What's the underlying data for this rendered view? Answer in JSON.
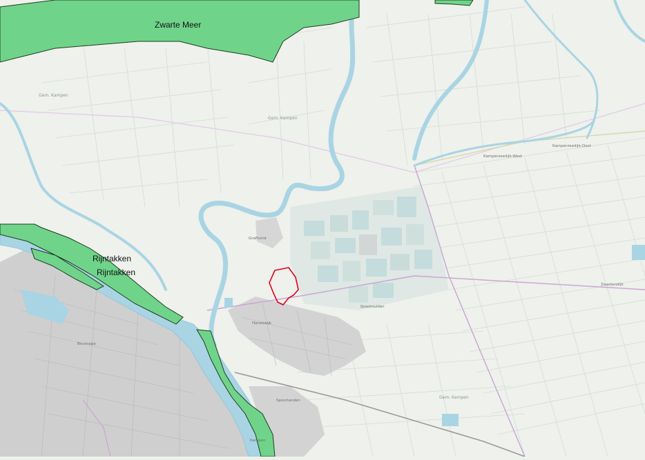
{
  "map": {
    "colors": {
      "background": "#eef1ec",
      "water": "#a9d4e3",
      "water_stroke": "#8fc3d6",
      "natura": "#6fd48a",
      "natura_stroke": "#1f3a1f",
      "urban": "#c9c9c9",
      "greenhouse": "#c4dcdc",
      "parcel": "#dfe4df",
      "road_main": "#c9a4d2",
      "railway": "#9a9a9a",
      "highlight": "#e0001a"
    },
    "natura_labels": {
      "zwarte_meer": "Zwarte Meer",
      "rijntakken_1": "Rijntakken",
      "rijntakken_2": "Rijntakken"
    },
    "place_labels": {
      "kampen": "Kampen",
      "ijsselmuiden": "IJsselmuiden",
      "grafhorst": "Grafhorst",
      "gem_kampen_nw": "Gem. Kampen",
      "gem_kampen_c": "Gem. Kampen",
      "gem_kampen_se": "Gem. Kampen",
      "kamperzeedijk": "Kamperzeedijk-West",
      "zuidelijk": "Kamperzeedijk-Oost",
      "spoorlanden": "Spoorlanden",
      "brunnepe": "Brunnepe",
      "hanzewijk": "Hanzewijk",
      "slot": "Zwartendijk"
    }
  }
}
